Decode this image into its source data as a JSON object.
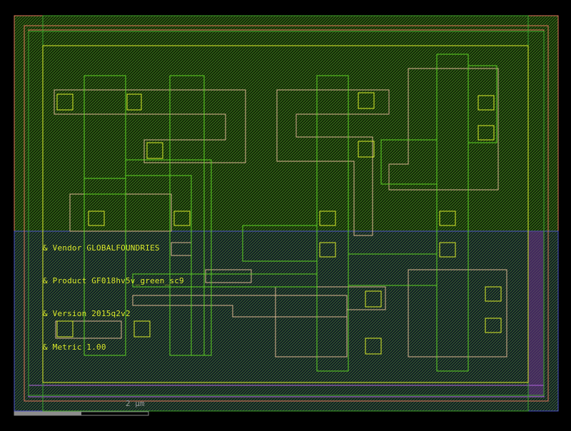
{
  "layout_view": {
    "labels": [
      "& Vendor GLOBALFOUNDRIES",
      "& Product GF018hv5v_green_sc9",
      "& Version 2015q2v2",
      "& Metric 1.00"
    ],
    "scale_bar": {
      "text": "2 µm"
    }
  },
  "colors": {
    "background": "#000000",
    "hatch": "#2f6a10",
    "upper_region": "#e0705a",
    "lower_region": "#4a50c8",
    "outline_green": "#3c9e2a",
    "outline_yellow": "#d8e62a",
    "outline_tan": "#d8b090",
    "outline_lime": "#5acc22",
    "outline_purple": "#b060e0",
    "label": "#d8e62a",
    "scale_bar": "#8c8c8c"
  }
}
